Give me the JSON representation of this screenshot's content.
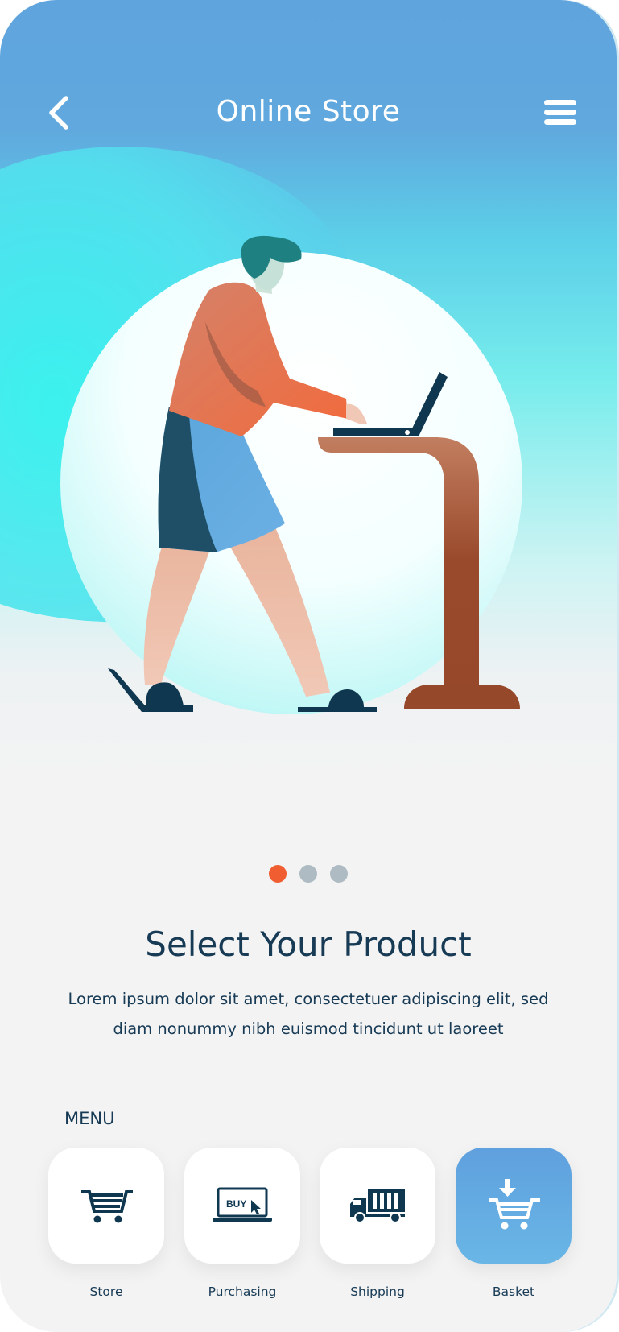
{
  "header": {
    "title": "Online Store",
    "back_icon": "chevron-left-icon",
    "menu_icon": "hamburger-menu-icon"
  },
  "carousel": {
    "active_index": 0,
    "count": 3
  },
  "content": {
    "headline": "Select Your Product",
    "description": "Lorem ipsum dolor sit amet, consectetuer adipiscing elit, sed diam nonummy nibh euismod tincidunt ut laoreet"
  },
  "menu": {
    "label": "MENU",
    "items": [
      {
        "label": "Store",
        "icon": "shopping-cart-icon"
      },
      {
        "label": "Purchasing",
        "icon": "laptop-buy-icon",
        "icon_text": "BUY"
      },
      {
        "label": "Shipping",
        "icon": "delivery-truck-icon"
      },
      {
        "label": "Basket",
        "icon": "cart-download-icon",
        "active": true
      }
    ]
  },
  "colors": {
    "accent": "#f05d30",
    "dark_text": "#173a55",
    "inactive_dot": "#aebbc3",
    "active_card": "#63a8e0"
  }
}
